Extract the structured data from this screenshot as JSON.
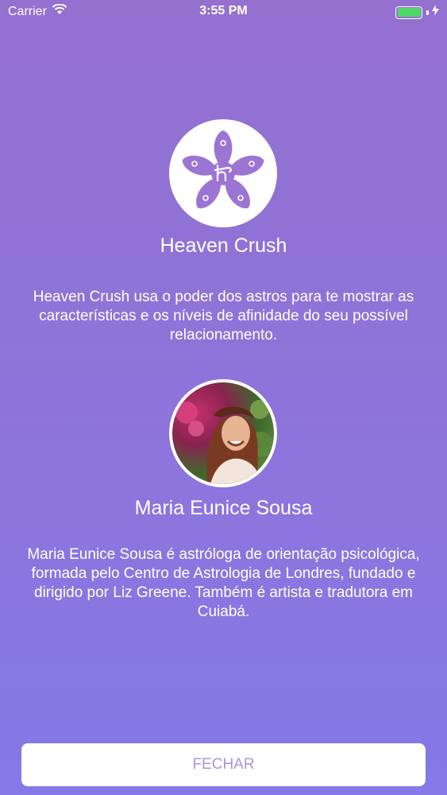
{
  "status_bar": {
    "carrier": "Carrier",
    "time": "3:55 PM",
    "battery_level": 1.0,
    "battery_color": "#4cd964"
  },
  "app": {
    "logo_icon": "heaven-crush-flower-logo",
    "name": "Heaven Crush",
    "description": "Heaven Crush usa o poder dos astros para te mostrar as características e os níveis de afinidade do seu possível relacionamento."
  },
  "author": {
    "avatar": "author-photo",
    "name": "Maria Eunice Sousa",
    "bio": "Maria Eunice Sousa é astróloga de orientação psicológica, formada pelo Centro de Astrologia de Londres, fundado e dirigido por Liz Greene. Também é artista e tradutora em Cuiabá."
  },
  "actions": {
    "close_label": "FECHAR"
  },
  "colors": {
    "background_top": "#9470cf",
    "background_bottom": "#8479e6",
    "button_text": "#a796dc",
    "logo_petal": "#9c74d4"
  }
}
